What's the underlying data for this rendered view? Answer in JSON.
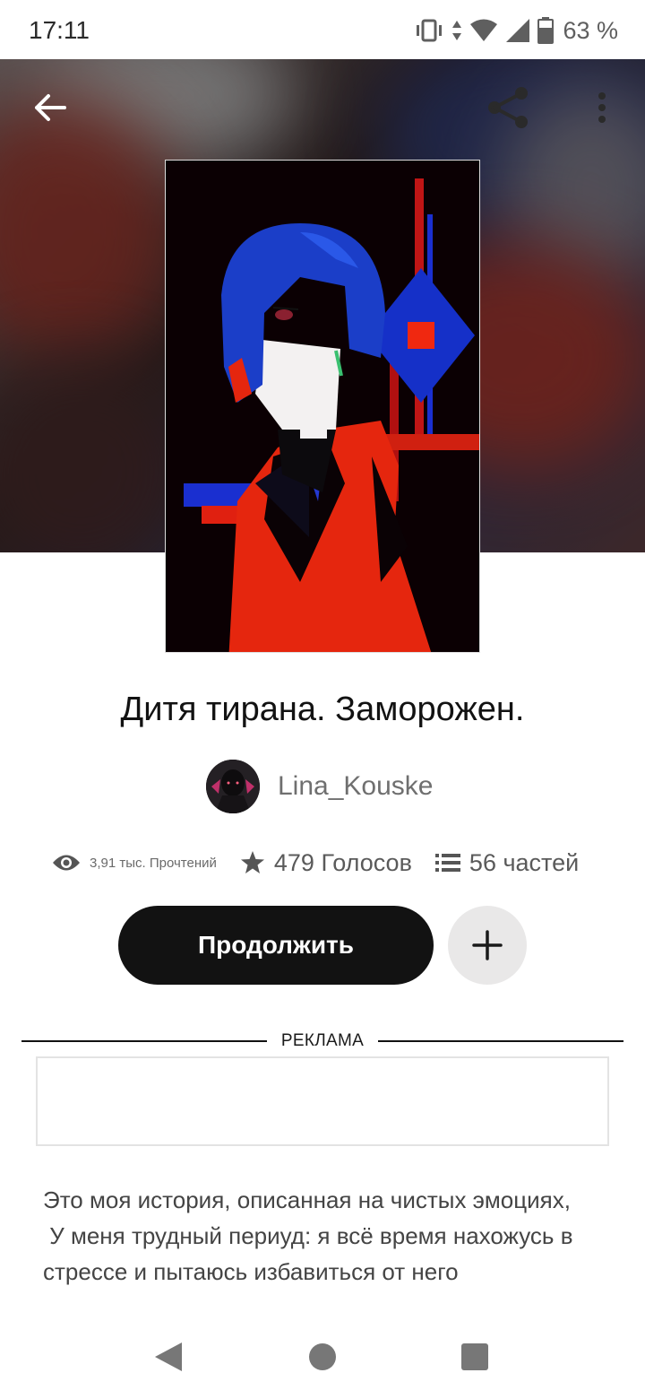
{
  "status_bar": {
    "time": "17:11",
    "battery": "63 %",
    "icons": [
      "vibrate-icon",
      "data-arrows-icon",
      "wifi-icon",
      "signal-icon",
      "battery-icon"
    ]
  },
  "header": {
    "back_icon": "arrow-back-icon",
    "share_icon": "share-icon",
    "more_icon": "more-vertical-icon"
  },
  "story": {
    "title": "Дитя тирана. Заморожен.",
    "author": "Lina_Kouske",
    "stats": {
      "reads": "3,91 тыс. Прочтений",
      "votes": "479 Голосов",
      "parts": "56 частей"
    },
    "continue_label": "Продолжить",
    "add_icon": "plus-icon",
    "description": "Это моя история, описанная на чистых эмоциях,\n У меня трудный периуд: я всё время нахожусь в стрессе и пытаюсь избавиться от него"
  },
  "ad": {
    "label": "РЕКЛАМА"
  },
  "colors": {
    "accent": "#121212",
    "secondary_button": "#e9e8e8",
    "cover_blue": "#1a2fd0",
    "cover_red": "#f02810"
  }
}
